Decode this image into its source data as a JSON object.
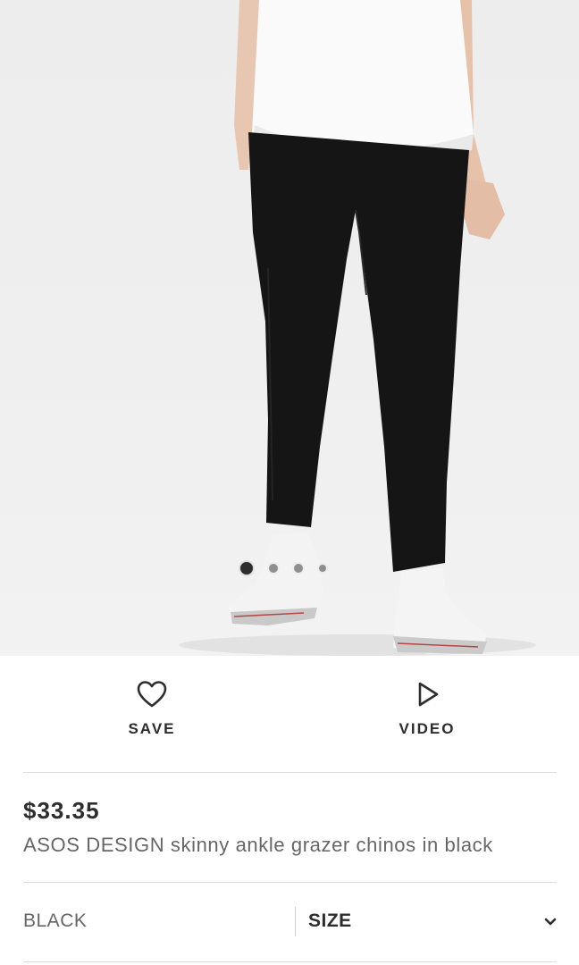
{
  "gallery": {
    "image_description": "",
    "slide_count": 4,
    "active_slide": 1
  },
  "actions": {
    "save_label": "SAVE",
    "save_icon": "heart-outline-icon",
    "video_label": "VIDEO",
    "video_icon": "play-outline-icon"
  },
  "product": {
    "price": "$33.35",
    "name": "ASOS DESIGN skinny ankle grazer chinos in black"
  },
  "options": {
    "colour": "BLACK",
    "size_label": "SIZE",
    "size_icon": "chevron-down-icon"
  },
  "colors": {
    "text_primary": "#2d2d2d",
    "text_secondary": "#666666",
    "divider": "#dddddd",
    "dot_active": "#2d2d2d",
    "dot_inactive": "#8f8f8f"
  }
}
